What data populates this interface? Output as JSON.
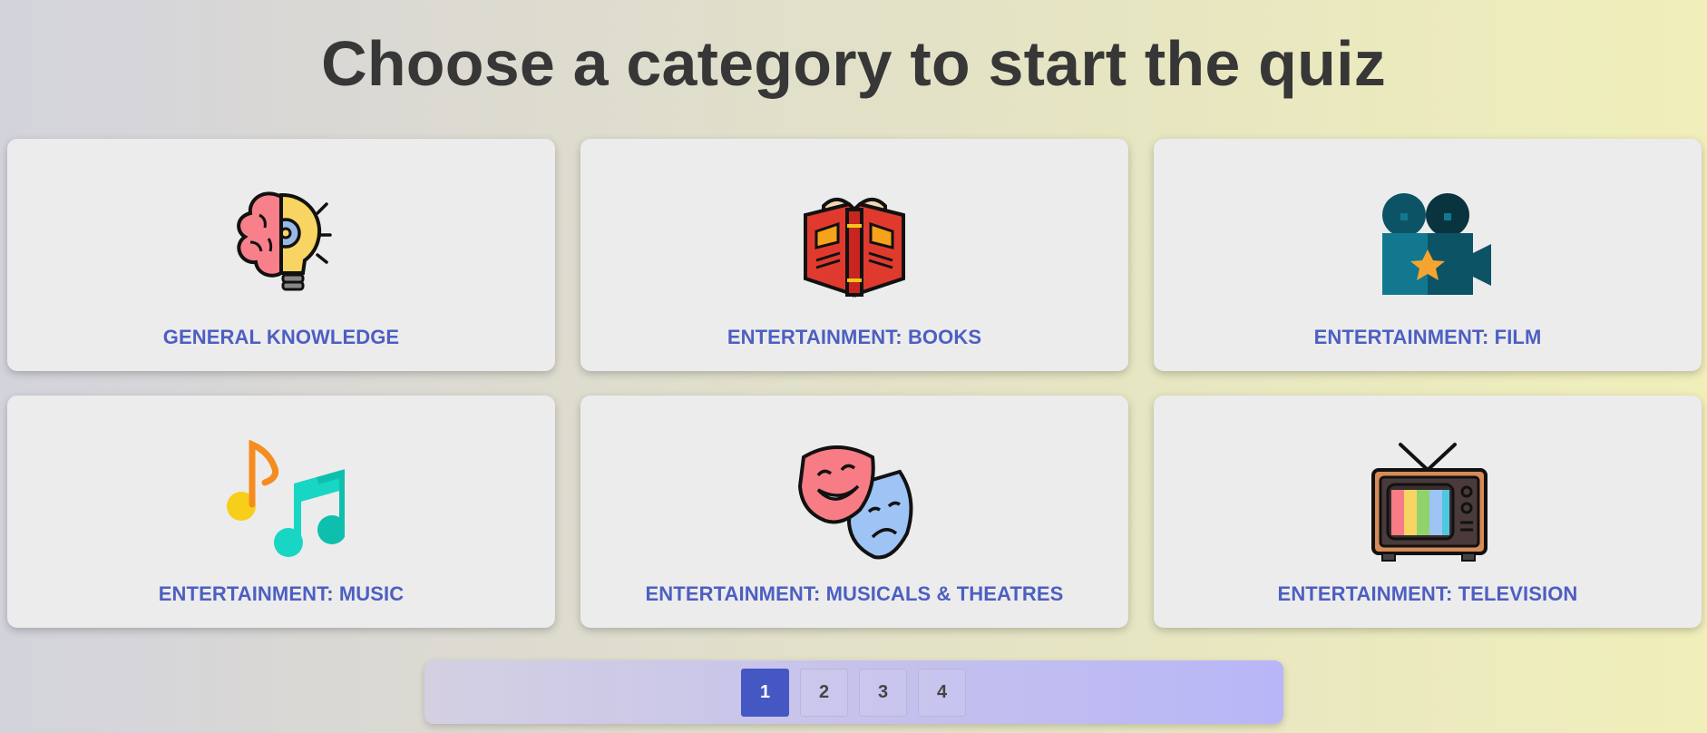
{
  "page": {
    "title": "Choose a category to start the quiz"
  },
  "categories": [
    {
      "label": "GENERAL KNOWLEDGE",
      "icon": "brain-lightbulb-icon"
    },
    {
      "label": "ENTERTAINMENT: BOOKS",
      "icon": "open-book-icon"
    },
    {
      "label": "ENTERTAINMENT: FILM",
      "icon": "movie-camera-icon"
    },
    {
      "label": "ENTERTAINMENT: MUSIC",
      "icon": "music-notes-icon"
    },
    {
      "label": "ENTERTAINMENT: MUSICALS & THEATRES",
      "icon": "theatre-masks-icon"
    },
    {
      "label": "ENTERTAINMENT: TELEVISION",
      "icon": "television-icon"
    }
  ],
  "pagination": {
    "pages": [
      "1",
      "2",
      "3",
      "4"
    ],
    "current": "1"
  },
  "colors": {
    "label": "#4d5fc1",
    "active_page": "#4557c3",
    "title": "#373737",
    "card": "#ececed"
  }
}
